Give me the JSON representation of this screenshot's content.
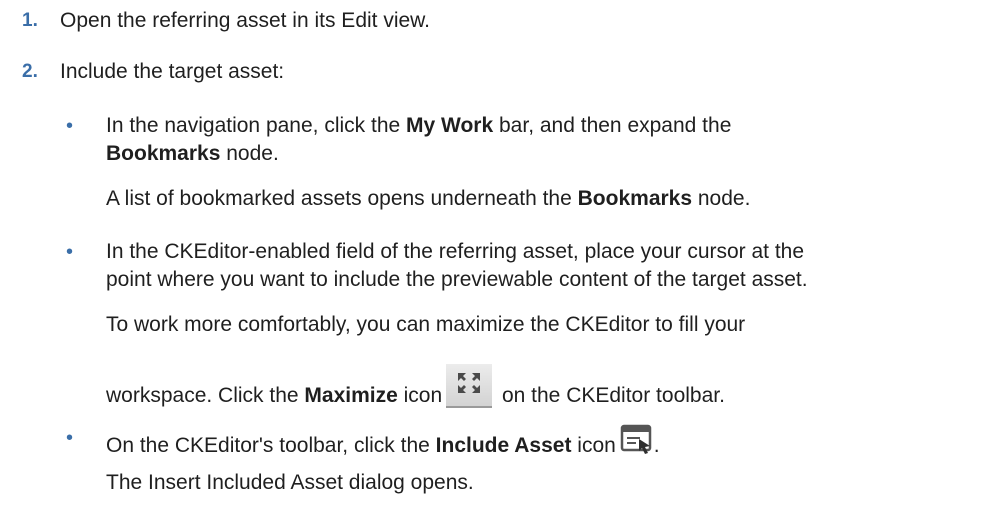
{
  "steps": [
    {
      "number": "1.",
      "text": "Open the referring asset in its Edit view."
    },
    {
      "number": "2.",
      "text": "Include the target asset:"
    }
  ],
  "bullet_char": "•",
  "bullet1": {
    "t1": "In the navigation pane, click the ",
    "b1": "My Work",
    "t2": " bar, and then expand the",
    "b2": "Bookmarks",
    "t3": " node.",
    "note_t1": "A list of bookmarked assets opens underneath the ",
    "note_b1": "Bookmarks",
    "note_t2": " node."
  },
  "bullet2": {
    "line1": "In the CKEditor-enabled field of the referring asset, place your cursor at the",
    "line2": "point where you want to include the previewable content of the target asset.",
    "note_line1": "To work more comfortably, you can maximize the CKEditor to fill your",
    "note_t1": "workspace. Click the ",
    "note_b1": "Maximize",
    "note_t2": " icon",
    "note_t3": " on the CKEditor toolbar.",
    "icon": "maximize-icon"
  },
  "bullet3": {
    "t1": "On the CKEditor's toolbar, click the ",
    "b1": "Include Asset",
    "t2": " icon",
    "t3": ".",
    "icon": "include-asset-icon",
    "note": "The Insert Included Asset dialog opens."
  },
  "colors": {
    "accent": "#3a6ea8",
    "text": "#1f1f1f"
  }
}
